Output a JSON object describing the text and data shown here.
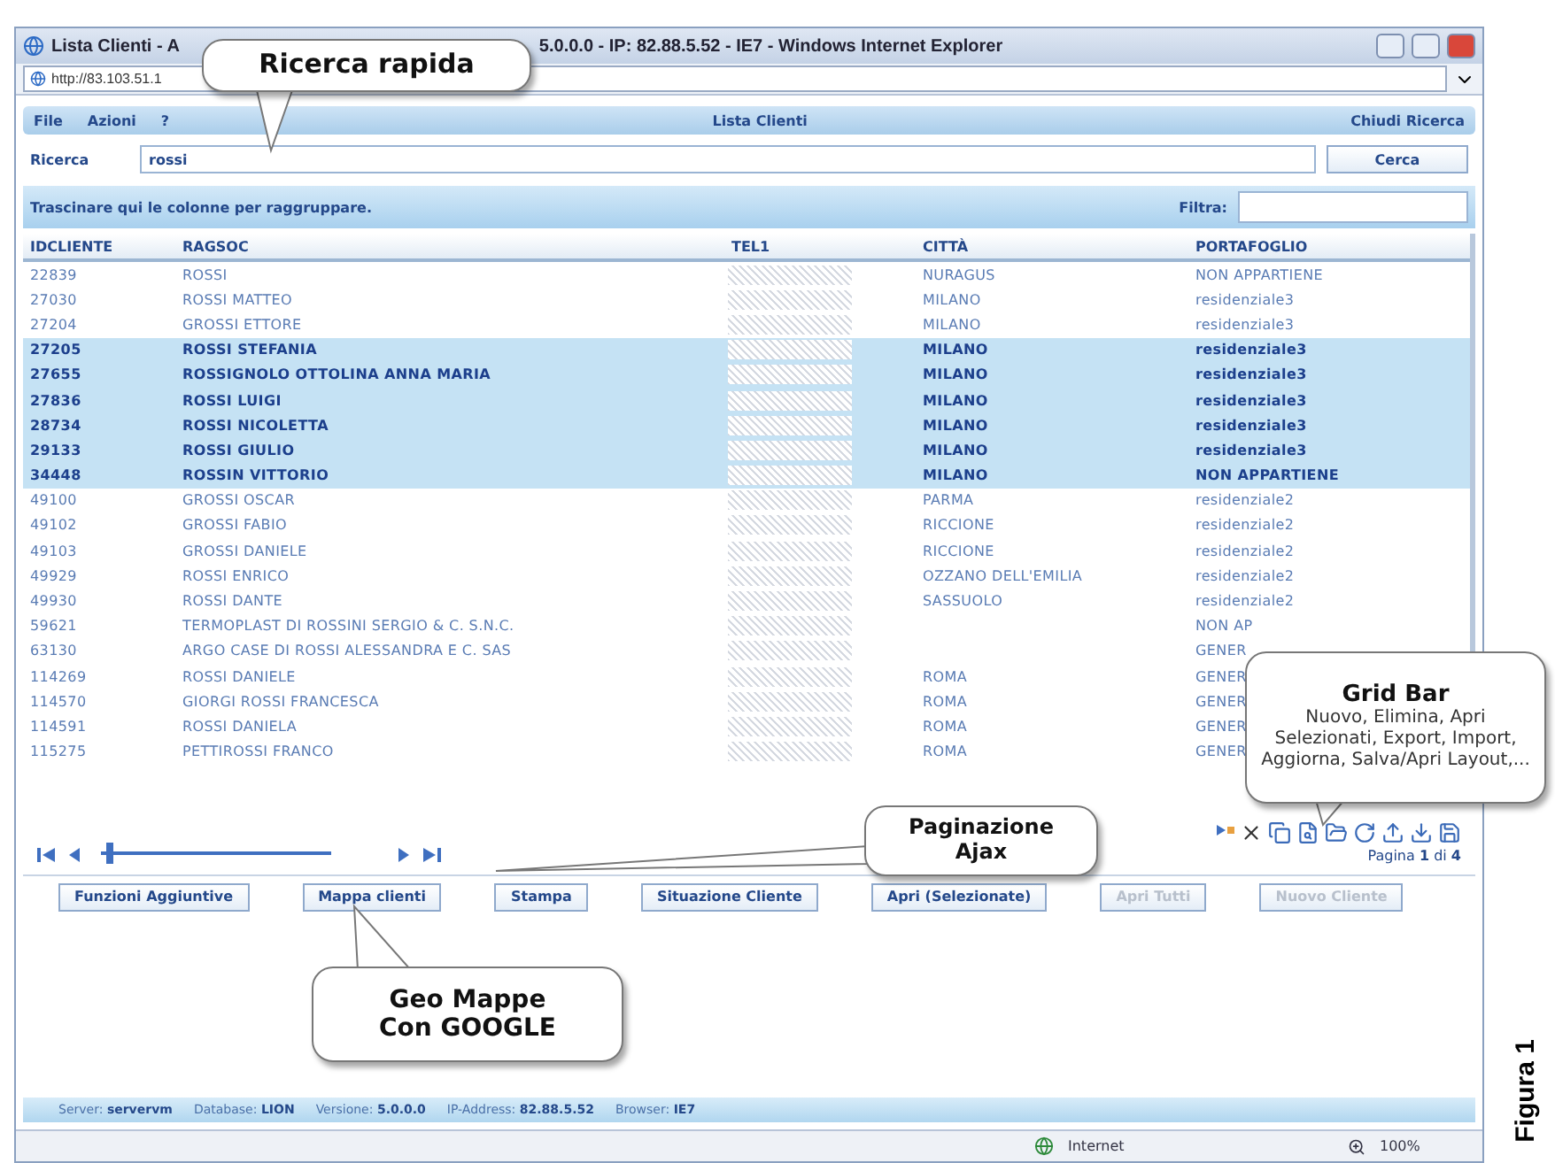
{
  "window": {
    "title_left": "Lista Clienti - A",
    "title_right": "5.0.0.0 - IP: 82.88.5.52 - IE7 - Windows Internet Explorer"
  },
  "address_bar": {
    "url": "http://83.103.51.1"
  },
  "menu": {
    "items": [
      "File",
      "Azioni",
      "?"
    ],
    "title": "Lista Clienti",
    "close_search": "Chiudi Ricerca"
  },
  "search": {
    "label": "Ricerca",
    "value": "rossi",
    "button": "Cerca"
  },
  "group_bar": {
    "hint": "Trascinare qui le colonne per raggruppare.",
    "filter_label": "Filtra:"
  },
  "table": {
    "columns": [
      "IDCLIENTE",
      "RAGSOC",
      "TEL1",
      "CITTÀ",
      "PORTAFOGLIO"
    ],
    "rows": [
      {
        "id": "22839",
        "ragsoc": "ROSSI",
        "citta": "NURAGUS",
        "portafoglio": "NON APPARTIENE",
        "selected": false
      },
      {
        "id": "27030",
        "ragsoc": "ROSSI MATTEO",
        "citta": "MILANO",
        "portafoglio": "residenziale3",
        "selected": false
      },
      {
        "id": "27204",
        "ragsoc": "GROSSI ETTORE",
        "citta": "MILANO",
        "portafoglio": "residenziale3",
        "selected": false
      },
      {
        "id": "27205",
        "ragsoc": "ROSSI STEFANIA",
        "citta": "MILANO",
        "portafoglio": "residenziale3",
        "selected": true
      },
      {
        "id": "27655",
        "ragsoc": "ROSSIGNOLO OTTOLINA ANNA MARIA",
        "citta": "MILANO",
        "portafoglio": "residenziale3",
        "selected": true
      },
      {
        "id": "27836",
        "ragsoc": "ROSSI LUIGI",
        "citta": "MILANO",
        "portafoglio": "residenziale3",
        "selected": true
      },
      {
        "id": "28734",
        "ragsoc": "ROSSI NICOLETTA",
        "citta": "MILANO",
        "portafoglio": "residenziale3",
        "selected": true
      },
      {
        "id": "29133",
        "ragsoc": "ROSSI GIULIO",
        "citta": "MILANO",
        "portafoglio": "residenziale3",
        "selected": true
      },
      {
        "id": "34448",
        "ragsoc": "ROSSIN VITTORIO",
        "citta": "MILANO",
        "portafoglio": "NON APPARTIENE",
        "selected": true
      },
      {
        "id": "49100",
        "ragsoc": "GROSSI OSCAR",
        "citta": "PARMA",
        "portafoglio": "residenziale2",
        "selected": false
      },
      {
        "id": "49102",
        "ragsoc": "GROSSI FABIO",
        "citta": "RICCIONE",
        "portafoglio": "residenziale2",
        "selected": false
      },
      {
        "id": "49103",
        "ragsoc": "GROSSI DANIELE",
        "citta": "RICCIONE",
        "portafoglio": "residenziale2",
        "selected": false
      },
      {
        "id": "49929",
        "ragsoc": "ROSSI ENRICO",
        "citta": "OZZANO DELL'EMILIA",
        "portafoglio": "residenziale2",
        "selected": false
      },
      {
        "id": "49930",
        "ragsoc": "ROSSI DANTE",
        "citta": "SASSUOLO",
        "portafoglio": "residenziale2",
        "selected": false
      },
      {
        "id": "59621",
        "ragsoc": "TERMOPLAST DI ROSSINI SERGIO & C. S.N.C.",
        "portafoglio": "NON AP",
        "selected": false
      },
      {
        "id": "63130",
        "ragsoc": "ARGO CASE DI ROSSI ALESSANDRA E C. SAS",
        "portafoglio": "GENER",
        "selected": false
      },
      {
        "id": "114269",
        "ragsoc": "ROSSI DANIELE",
        "citta": "ROMA",
        "portafoglio": "GENER",
        "selected": false
      },
      {
        "id": "114570",
        "ragsoc": "GIORGI ROSSI FRANCESCA",
        "citta": "ROMA",
        "portafoglio": "GENER",
        "selected": false
      },
      {
        "id": "114591",
        "ragsoc": "ROSSI DANIELA",
        "citta": "ROMA",
        "portafoglio": "GENER",
        "selected": false
      },
      {
        "id": "115275",
        "ragsoc": "PETTIROSSI FRANCO",
        "citta": "ROMA",
        "portafoglio": "GENER",
        "selected": false
      }
    ]
  },
  "pager": {
    "level": 0.02
  },
  "grid_bar": {
    "page_info": "Pagina **1** di **4**"
  },
  "buttons": [
    {
      "label": "Funzioni Aggiuntive",
      "disabled": false
    },
    {
      "label": "Mappa clienti",
      "disabled": false
    },
    {
      "label": "Stampa",
      "disabled": false
    },
    {
      "label": "Situazione Cliente",
      "disabled": false
    },
    {
      "label": "Apri (Selezionate)",
      "disabled": false
    },
    {
      "label": "Apri Tutti",
      "disabled": true
    },
    {
      "label": "Nuovo Cliente",
      "disabled": true
    }
  ],
  "status_bar": [
    {
      "label": "Server:",
      "value": "servervm"
    },
    {
      "label": "Database:",
      "value": "LION"
    },
    {
      "label": "Versione:",
      "value": "5.0.0.0"
    },
    {
      "label": "IP-Address:",
      "value": "82.88.5.52"
    },
    {
      "label": "Browser:",
      "value": "IE7"
    }
  ],
  "browser_status": {
    "zone": "Internet",
    "zoom": "100%"
  },
  "callouts": [
    {
      "kind": "search",
      "title": "Ricerca rapida"
    },
    {
      "kind": "grid",
      "title": "Grid Bar",
      "text": "Nuovo, Elimina, Apri Selezionati, Export, Import, Aggiorna, Salva/Apri Layout,..."
    },
    {
      "kind": "pager",
      "title": "Paginazione Ajax"
    },
    {
      "kind": "map",
      "title": "Geo Mappe Con GOOGLE"
    }
  ],
  "figure_label": "Figura 1"
}
